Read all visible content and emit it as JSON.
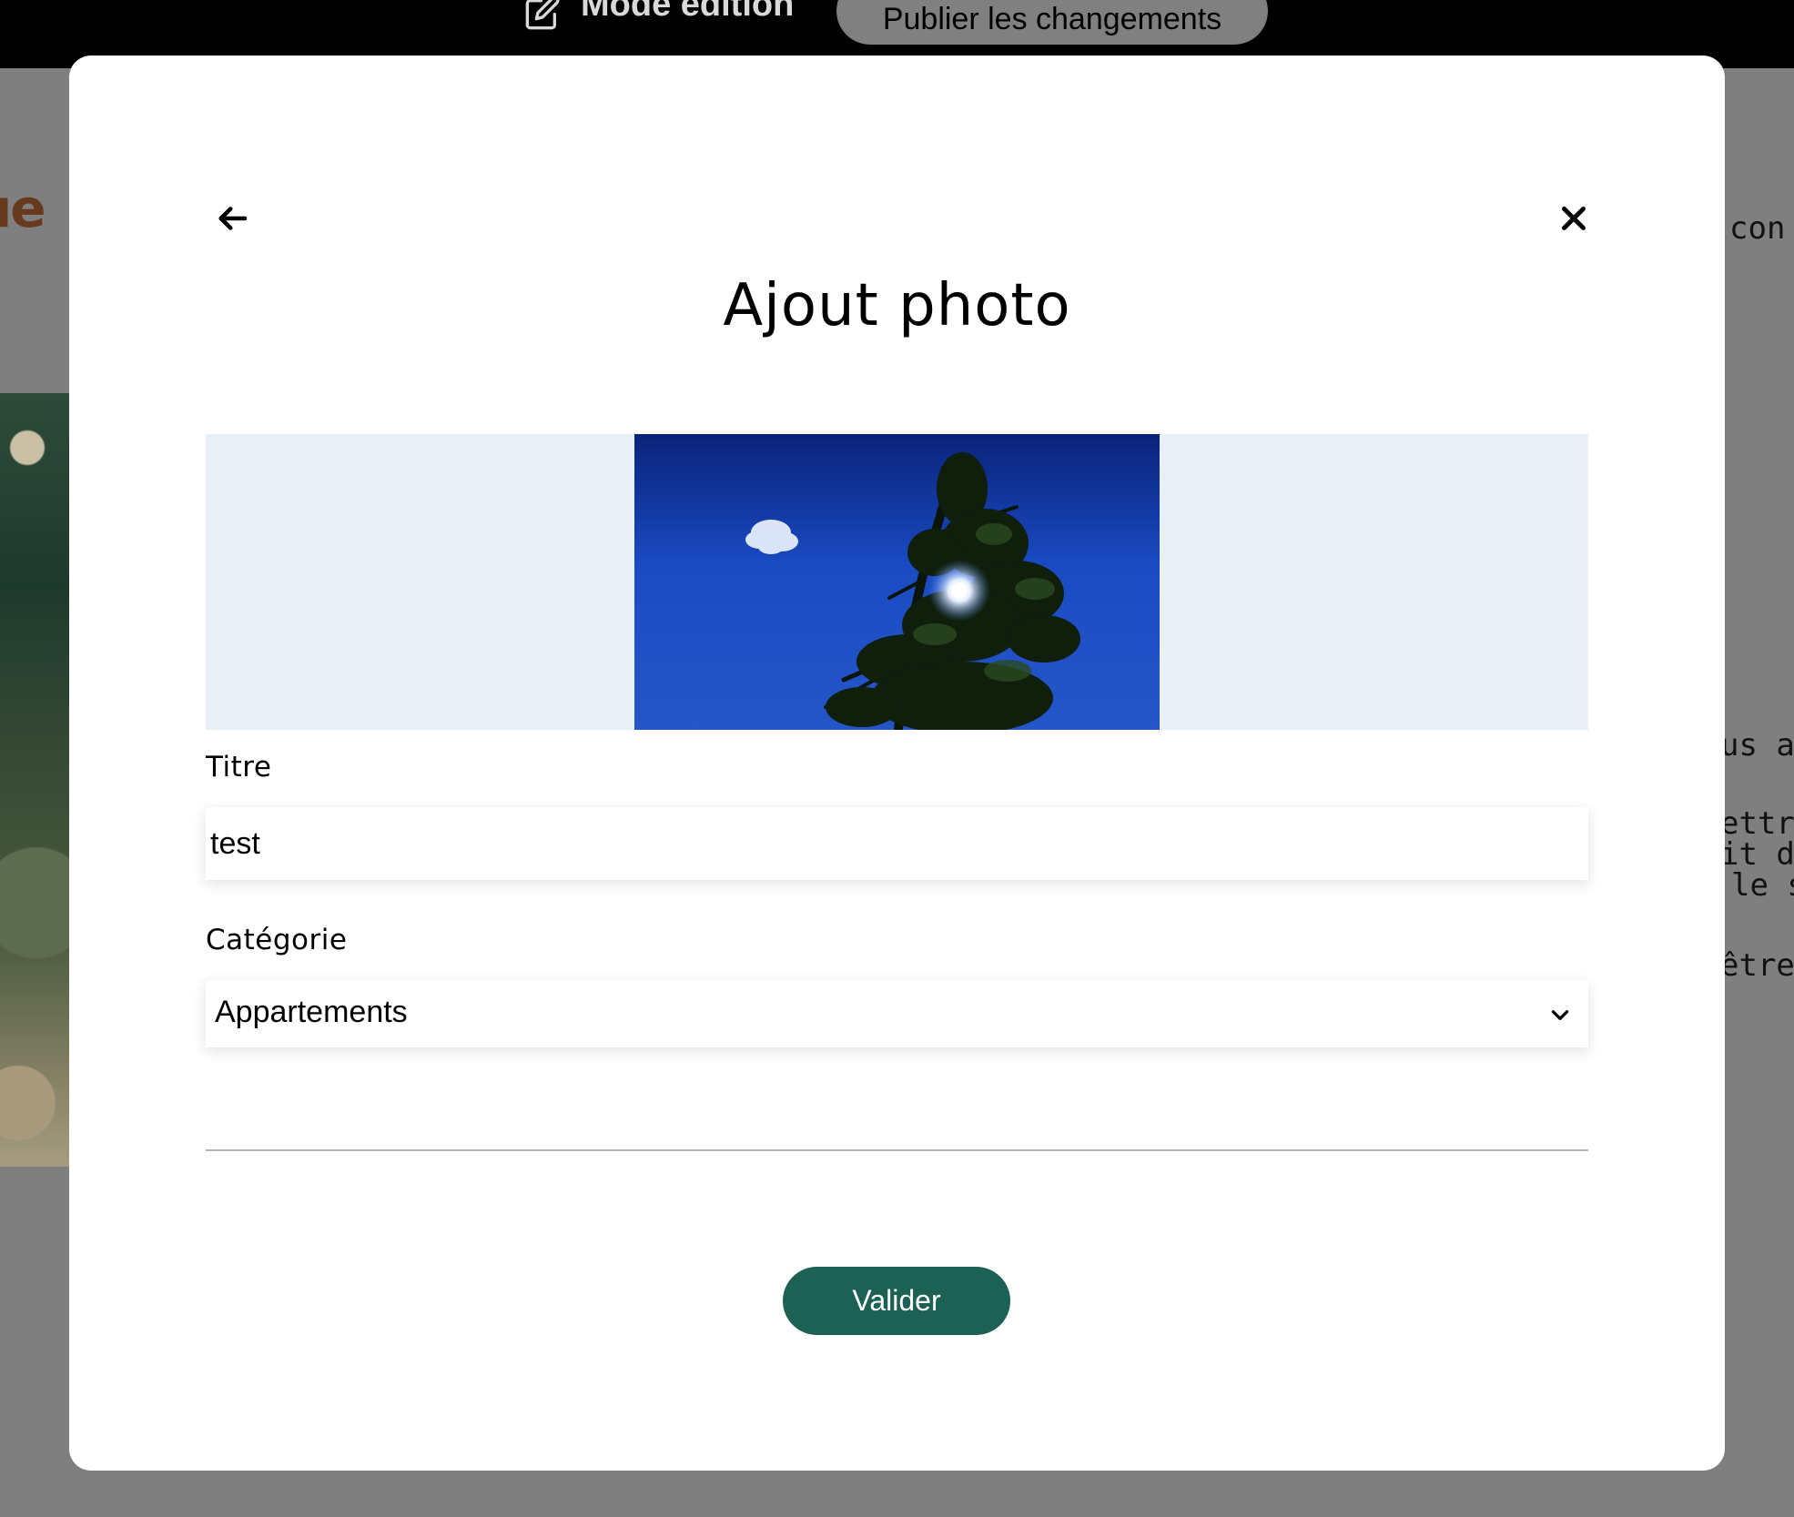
{
  "topbar": {
    "mode_label": "Mode édition",
    "publish_label": "Publier les changements"
  },
  "background": {
    "heading_fragment": "ue",
    "text_fragments": [
      "con",
      "us ac",
      "ettre",
      "it de",
      "le so",
      "être"
    ]
  },
  "modal": {
    "title": "Ajout photo",
    "back_icon": "arrow-left-icon",
    "close_icon": "close-icon",
    "form": {
      "title_label": "Titre",
      "title_value": "test",
      "category_label": "Catégorie",
      "category_selected": "Appartements",
      "submit_label": "Valider"
    }
  },
  "colors": {
    "overlay": "#7f7f7f",
    "submit_button": "#1d6154",
    "preview_background": "#e8f0f6",
    "heading_accent": "#67391d"
  }
}
